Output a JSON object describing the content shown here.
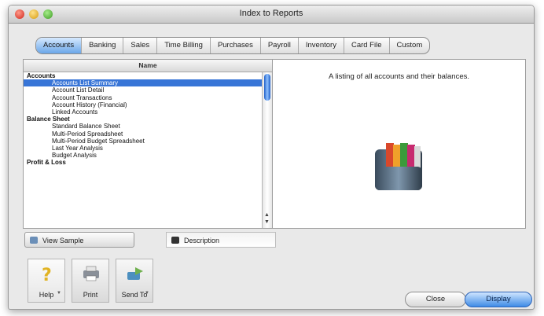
{
  "window": {
    "title": "Index to Reports"
  },
  "tabs": [
    {
      "label": "Accounts",
      "active": true
    },
    {
      "label": "Banking",
      "active": false
    },
    {
      "label": "Sales",
      "active": false
    },
    {
      "label": "Time Billing",
      "active": false
    },
    {
      "label": "Purchases",
      "active": false
    },
    {
      "label": "Payroll",
      "active": false
    },
    {
      "label": "Inventory",
      "active": false
    },
    {
      "label": "Card File",
      "active": false
    },
    {
      "label": "Custom",
      "active": false
    }
  ],
  "report_list": {
    "header": "Name",
    "rows": [
      {
        "label": "Accounts",
        "type": "category"
      },
      {
        "label": "Accounts List Summary",
        "type": "item",
        "selected": true
      },
      {
        "label": "Account List Detail",
        "type": "item"
      },
      {
        "label": "Account Transactions",
        "type": "item"
      },
      {
        "label": "Account History (Financial)",
        "type": "item"
      },
      {
        "label": "Linked Accounts",
        "type": "item"
      },
      {
        "label": "Balance Sheet",
        "type": "category"
      },
      {
        "label": "Standard Balance Sheet",
        "type": "item"
      },
      {
        "label": "Multi-Period Spreadsheet",
        "type": "item"
      },
      {
        "label": "Multi-Period Budget Spreadsheet",
        "type": "item"
      },
      {
        "label": "Last Year Analysis",
        "type": "item"
      },
      {
        "label": "Budget Analysis",
        "type": "item"
      },
      {
        "label": "Profit & Loss",
        "type": "category"
      }
    ]
  },
  "detail": {
    "description": "A listing of all accounts and their balances."
  },
  "view_toggles": {
    "left": "View Sample",
    "right": "Description"
  },
  "toolbar": {
    "help": "Help",
    "print": "Print",
    "send_to": "Send To"
  },
  "buttons": {
    "close": "Close",
    "display": "Display"
  },
  "colors": {
    "accent": "#3875d7",
    "display_button": "#3f8ce6"
  }
}
